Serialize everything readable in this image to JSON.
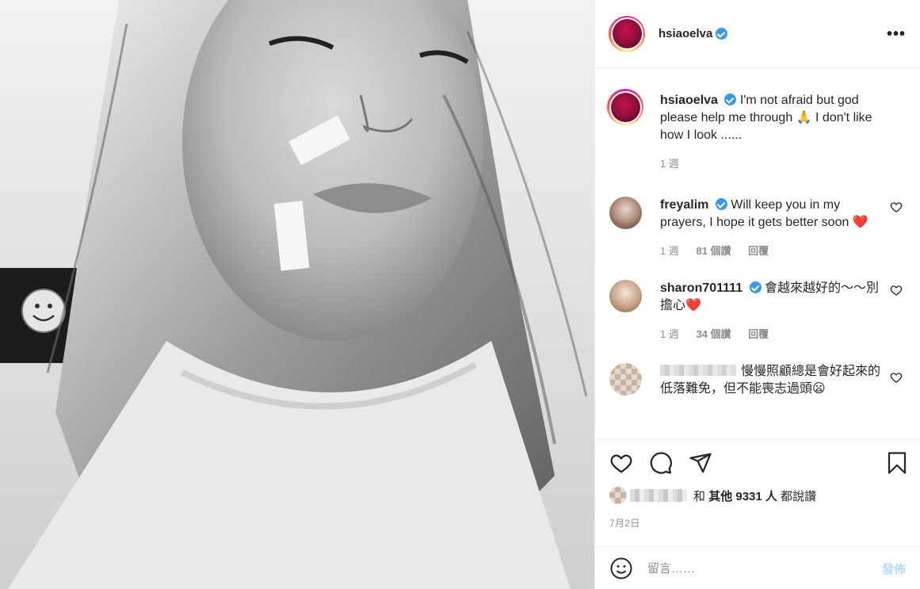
{
  "post": {
    "username": "hsiaoelva",
    "verified": true,
    "more_icon": "more-dots-icon",
    "image_alt": "black and white selfie with bandages on face"
  },
  "caption": {
    "username": "hsiaoelva",
    "text": "I'm not afraid but god please help me through 🙏 I don't like how I look ......",
    "time": "1 週"
  },
  "comments": [
    {
      "username": "freyalim",
      "text": "Will keep you in my prayers, I hope it gets better soon ❤️",
      "time": "1 週",
      "likes": "81 個讚",
      "reply": "回覆"
    },
    {
      "username": "sharon701111",
      "text": "會越來越好的～～別擔心❤️",
      "time": "1 週",
      "likes": "34 個讚",
      "reply": "回覆"
    },
    {
      "username": "",
      "text": "慢慢照顧總是會好起來的\n低落難免，但不能喪志過頭😦"
    }
  ],
  "actions": {
    "likes_prefix": "和",
    "likes_bold": "其他 9331 人",
    "likes_suffix": "都說讚",
    "date": "7月2日"
  },
  "add_comment": {
    "placeholder": "留言……",
    "post_label": "發佈"
  },
  "colors": {
    "accent": "#3897f0",
    "post_disabled": "#b2dffc",
    "heart": "#ed4956"
  }
}
